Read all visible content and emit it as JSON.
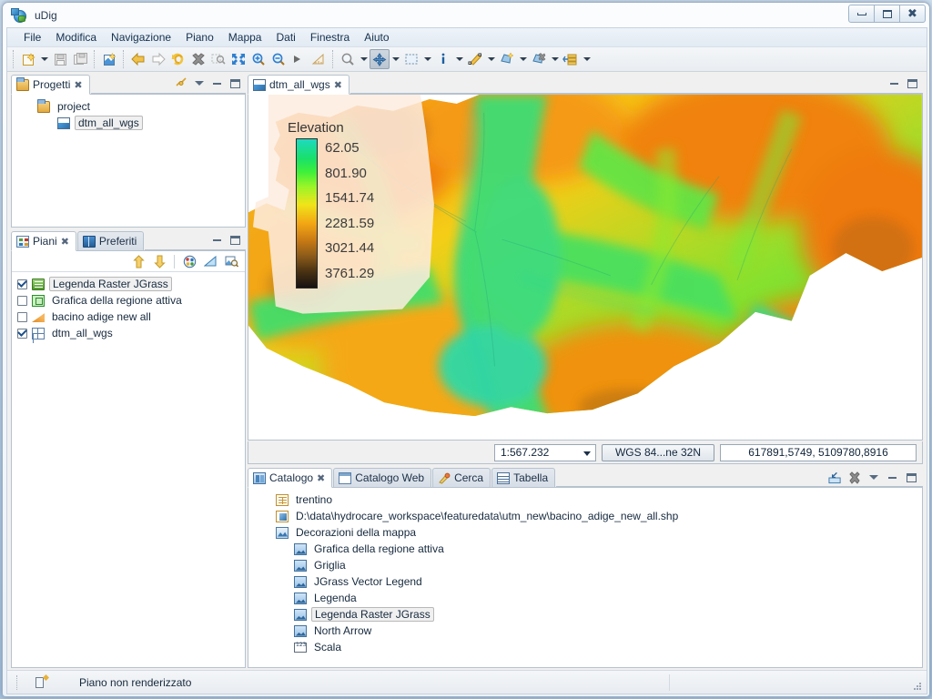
{
  "window": {
    "title": "uDig",
    "icon": "udig-globe-icon",
    "buttons": {
      "minimize": "–",
      "maximize": "□",
      "close": "✕"
    }
  },
  "menubar": {
    "items": [
      {
        "label": "File"
      },
      {
        "label": "Modifica"
      },
      {
        "label": "Navigazione"
      },
      {
        "label": "Piano"
      },
      {
        "label": "Mappa"
      },
      {
        "label": "Dati"
      },
      {
        "label": "Finestra"
      },
      {
        "label": "Aiuto"
      }
    ]
  },
  "toolbar": {
    "groups": [
      {
        "buttons": [
          {
            "name": "new-icon",
            "arrow": true
          },
          {
            "name": "save-icon",
            "arrow": false
          },
          {
            "name": "save-all-icon",
            "arrow": false
          }
        ]
      },
      {
        "buttons": [
          {
            "name": "new-map-icon",
            "arrow": false
          }
        ]
      },
      {
        "buttons": [
          {
            "name": "back-arrow-icon",
            "arrow": false
          },
          {
            "name": "forward-arrow-icon",
            "arrow": false
          },
          {
            "name": "refresh-icon",
            "arrow": false
          },
          {
            "name": "stop-render-icon",
            "arrow": false
          },
          {
            "name": "zoom-selection-icon",
            "arrow": false
          },
          {
            "name": "zoom-extent-icon",
            "arrow": false
          },
          {
            "name": "zoom-in-icon",
            "arrow": false
          },
          {
            "name": "zoom-out-icon",
            "arrow": false
          },
          {
            "name": "pan-step-icon",
            "arrow": false
          },
          {
            "name": "measure-icon",
            "arrow": false
          }
        ]
      },
      {
        "buttons": [
          {
            "name": "zoom-tool-icon",
            "arrow": true
          },
          {
            "name": "pan-tool-icon",
            "arrow": true,
            "active": true
          },
          {
            "name": "select-box-icon",
            "arrow": true
          },
          {
            "name": "info-tool-icon",
            "arrow": true
          },
          {
            "name": "edit-geometry-icon",
            "arrow": true
          },
          {
            "name": "create-feature-icon",
            "arrow": true
          },
          {
            "name": "delete-feature-icon",
            "arrow": true
          },
          {
            "name": "layer-tools-icon",
            "arrow": true
          }
        ]
      }
    ]
  },
  "projects_view": {
    "tab": {
      "label": "Progetti",
      "icon": "project-folder-icon",
      "close": "✖"
    },
    "tools": [
      {
        "name": "link-with-editor-icon"
      },
      {
        "name": "view-menu-icon"
      },
      {
        "name": "minimize-icon"
      },
      {
        "name": "maximize-icon"
      }
    ],
    "tree": [
      {
        "label": "project",
        "icon": "folder-icon",
        "indent": 0,
        "selected": false
      },
      {
        "label": "dtm_all_wgs",
        "icon": "map-icon",
        "indent": 1,
        "selected": true
      }
    ]
  },
  "layers_view": {
    "tabs": [
      {
        "label": "Piani",
        "icon": "layers-icon",
        "selected": true,
        "close": "✖"
      },
      {
        "label": "Preferiti",
        "icon": "bookmarks-icon",
        "selected": false
      }
    ],
    "tools": [
      {
        "name": "minimize-icon"
      },
      {
        "name": "maximize-icon"
      }
    ],
    "toolbar_buttons": [
      {
        "name": "move-layer-up-icon"
      },
      {
        "name": "move-layer-down-icon"
      },
      {
        "name": "style-editor-icon"
      },
      {
        "name": "transparency-icon"
      },
      {
        "name": "zoom-to-layer-icon"
      }
    ],
    "layers": [
      {
        "label": "Legenda Raster JGrass",
        "checked": true,
        "icon": "legend-raster-icon",
        "selected": true
      },
      {
        "label": "Grafica della regione attiva",
        "checked": false,
        "icon": "region-box-icon",
        "selected": false
      },
      {
        "label": "bacino adige new all",
        "checked": false,
        "icon": "polygon-layer-icon",
        "selected": false
      },
      {
        "label": "dtm_all_wgs",
        "checked": true,
        "icon": "raster-grid-icon",
        "selected": false
      }
    ]
  },
  "map_editor": {
    "tab": {
      "label": "dtm_all_wgs",
      "icon": "map-icon",
      "close": "✖"
    },
    "tools": [
      {
        "name": "minimize-icon"
      },
      {
        "name": "maximize-icon"
      }
    ],
    "legend": {
      "title": "Elevation",
      "values": [
        "62.05",
        "801.90",
        "1541.74",
        "2281.59",
        "3021.44",
        "3761.29"
      ],
      "gradient_stops": [
        "#1fd9c0",
        "#19e06a",
        "#3ef03a",
        "#9af528",
        "#f0e41a",
        "#f2a513",
        "#c97b14",
        "#8a5a1a",
        "#4a3212",
        "#161212"
      ]
    },
    "status": {
      "scale": "1:567.232",
      "crs": "WGS 84...ne 32N",
      "coordinates": "617891,5749, 5109780,8916"
    }
  },
  "catalog_view": {
    "tabs": [
      {
        "label": "Catalogo",
        "icon": "catalog-icon",
        "selected": true,
        "close": "✖"
      },
      {
        "label": "Catalogo Web",
        "icon": "web-catalog-icon",
        "selected": false
      },
      {
        "label": "Cerca",
        "icon": "search-icon",
        "selected": false
      },
      {
        "label": "Tabella",
        "icon": "table-icon",
        "selected": false
      }
    ],
    "tools": [
      {
        "name": "add-to-map-icon"
      },
      {
        "name": "remove-icon"
      },
      {
        "name": "view-menu-icon"
      },
      {
        "name": "minimize-icon"
      },
      {
        "name": "maximize-icon"
      }
    ],
    "tree": [
      {
        "label": "trentino",
        "icon": "database-icon",
        "indent": 0,
        "selected": false
      },
      {
        "label": "D:\\data\\hydrocare_workspace\\featuredata\\utm_new\\bacino_adige_new_all.shp",
        "icon": "shapefile-icon",
        "indent": 0,
        "selected": false
      },
      {
        "label": "Decorazioni della mappa",
        "icon": "decoration-folder-icon",
        "indent": 0,
        "selected": false
      },
      {
        "label": "Grafica della regione attiva",
        "icon": "decoration-icon",
        "indent": 1,
        "selected": false
      },
      {
        "label": "Griglia",
        "icon": "decoration-icon",
        "indent": 1,
        "selected": false
      },
      {
        "label": "JGrass Vector Legend",
        "icon": "decoration-icon",
        "indent": 1,
        "selected": false
      },
      {
        "label": "Legenda",
        "icon": "decoration-icon",
        "indent": 1,
        "selected": false
      },
      {
        "label": "Legenda Raster JGrass",
        "icon": "decoration-icon",
        "indent": 1,
        "selected": true
      },
      {
        "label": "North Arrow",
        "icon": "decoration-icon",
        "indent": 1,
        "selected": false
      },
      {
        "label": "Scala",
        "icon": "scale-icon",
        "indent": 1,
        "selected": false
      }
    ]
  },
  "statusbar": {
    "icon": "render-status-icon",
    "message": "Piano non renderizzato"
  },
  "colors": {
    "accent": "#2a6fa8",
    "panel_bg": "#f0f0f0",
    "tab_selected": "#ffffff",
    "border": "#b6c2cf"
  }
}
